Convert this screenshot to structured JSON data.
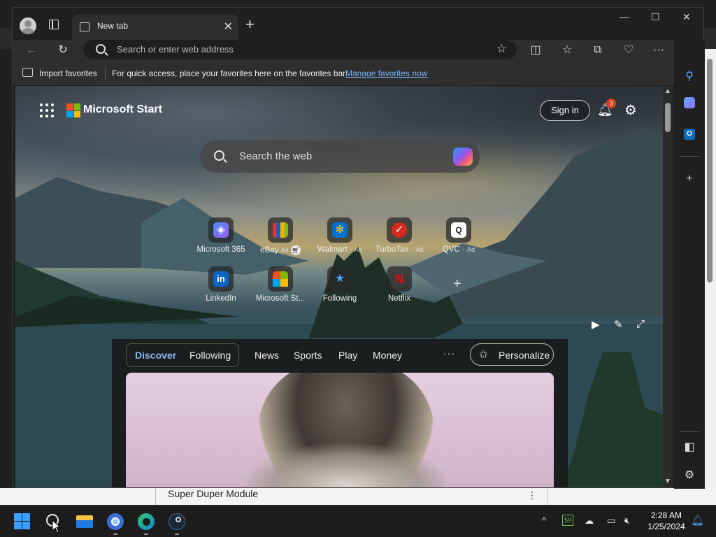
{
  "browser": {
    "tab_title": "New tab",
    "address_placeholder": "Search or enter web address",
    "favorites": {
      "import_label": "Import favorites",
      "hint": "For quick access, place your favorites here on the favorites bar.",
      "manage_link": "Manage favorites now"
    }
  },
  "start": {
    "brand": "Microsoft Start",
    "signin_label": "Sign in",
    "notification_count": "3",
    "search_placeholder": "Search the web",
    "tiles": [
      {
        "name": "Microsoft 365",
        "ad": "",
        "icon": "microsoft-365-icon"
      },
      {
        "name": "eBay",
        "ad": "Ad",
        "icon": "ebay-icon"
      },
      {
        "name": "Walmart",
        "ad": "Ad",
        "icon": "walmart-icon"
      },
      {
        "name": "TurboTax",
        "ad": "Ad",
        "icon": "turbotax-icon"
      },
      {
        "name": "QVC",
        "ad": "Ad",
        "icon": "qvc-icon"
      },
      {
        "name": "LinkedIn",
        "ad": "",
        "icon": "linkedin-icon"
      },
      {
        "name": "Microsoft St...",
        "ad": "",
        "icon": "microsoft-store-icon"
      },
      {
        "name": "Following",
        "ad": "",
        "icon": "following-icon"
      },
      {
        "name": "Netflix",
        "ad": "",
        "icon": "netflix-icon"
      }
    ],
    "feed": {
      "tab_discover": "Discover",
      "tab_following": "Following",
      "links": [
        "News",
        "Sports",
        "Play",
        "Money"
      ],
      "more": "···",
      "personalize": "Personalize"
    }
  },
  "background_app": {
    "title": "Super Duper Module"
  },
  "taskbar": {
    "time": "2:28 AM",
    "date": "1/25/2024",
    "tray_badge": "59"
  },
  "colors": {
    "accent_blue": "#3b9fff",
    "link_blue": "#7bb6ff",
    "badge_red": "#d4431e"
  }
}
